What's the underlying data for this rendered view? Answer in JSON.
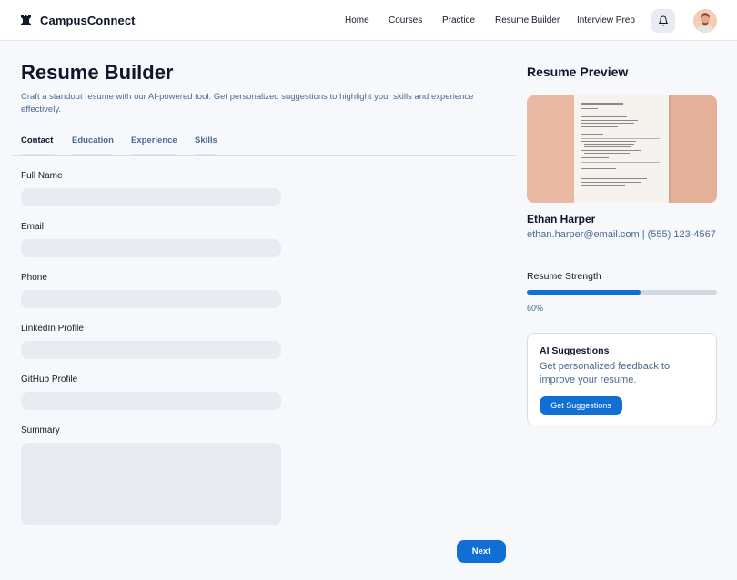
{
  "app": {
    "name": "CampusConnect",
    "logo_icon": "chess-rook-icon"
  },
  "nav": {
    "items": [
      {
        "label": "Home"
      },
      {
        "label": "Courses"
      },
      {
        "label": "Practice"
      },
      {
        "label": "Resume Builder"
      },
      {
        "label": "Interview Prep"
      }
    ],
    "notification_icon": "bell-icon",
    "avatar_icon": "user-avatar"
  },
  "main": {
    "title": "Resume Builder",
    "subtitle": "Craft a standout resume with our AI-powered tool. Get personalized suggestions to highlight your skills and experience effectively.",
    "tabs": [
      {
        "label": "Contact",
        "active": true
      },
      {
        "label": "Education",
        "active": false
      },
      {
        "label": "Experience",
        "active": false
      },
      {
        "label": "Skills",
        "active": false
      }
    ],
    "fields": [
      {
        "label": "Full Name",
        "value": ""
      },
      {
        "label": "Email",
        "value": ""
      },
      {
        "label": "Phone",
        "value": ""
      },
      {
        "label": "LinkedIn Profile",
        "value": ""
      },
      {
        "label": "GitHub Profile",
        "value": ""
      },
      {
        "label": "Summary",
        "value": ""
      }
    ],
    "next_label": "Next"
  },
  "preview": {
    "title": "Resume Preview",
    "name": "Ethan Harper",
    "contact": "ethan.harper@email.com | (555) 123-4567",
    "strength_label": "Resume Strength",
    "strength_value": 60,
    "strength_text": "60%"
  },
  "ai": {
    "title": "AI Suggestions",
    "description": "Get personalized feedback to improve your resume.",
    "button_label": "Get Suggestions"
  },
  "colors": {
    "accent": "#0f6fd4",
    "muted_text": "#4a6a8f",
    "input_bg": "#e8ecf2",
    "preview_bg": "#e8b7a0"
  }
}
